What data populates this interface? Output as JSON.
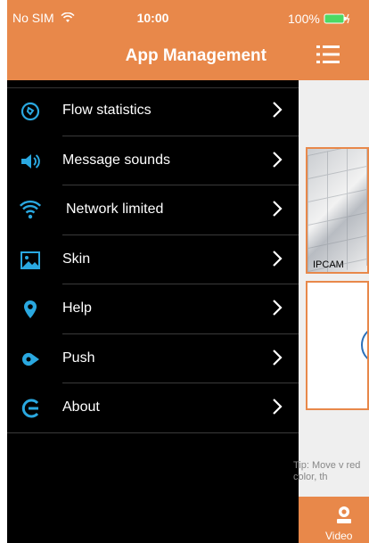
{
  "status_bar": {
    "carrier": "No SIM",
    "time": "10:00",
    "battery": "100%"
  },
  "drawer": {
    "title": "App Management",
    "items": [
      {
        "label": "Flow statistics",
        "icon": "flow-icon"
      },
      {
        "label": "Message sounds",
        "icon": "speaker-icon"
      },
      {
        "label": "Network limited",
        "icon": "wifi-icon"
      },
      {
        "label": "Skin",
        "icon": "image-icon"
      },
      {
        "label": "Help",
        "icon": "location-pin-icon"
      },
      {
        "label": "Push",
        "icon": "push-icon"
      },
      {
        "label": "About",
        "icon": "about-icon"
      }
    ]
  },
  "background_view": {
    "camera_caption": "IPCAM",
    "tip_text": "Tip: Move v red color, th",
    "tab_label": "Video"
  },
  "colors": {
    "accent": "#e8884a",
    "icon_blue": "#2aa8e0",
    "drawer_bg": "#000000"
  }
}
